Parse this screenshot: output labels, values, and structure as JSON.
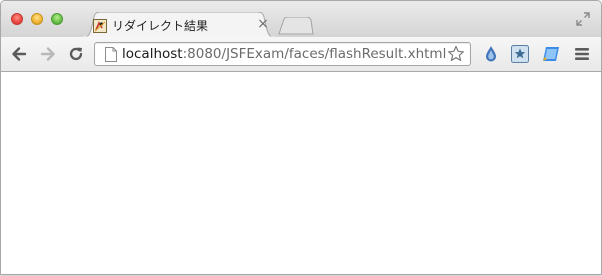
{
  "window": {
    "controls": [
      "close-icon",
      "minimize-icon",
      "zoom-icon"
    ]
  },
  "tabs": [
    {
      "title": "リダイレクト結果",
      "favicon": "java-duke-favicon-icon",
      "close_glyph": "×",
      "active": true
    }
  ],
  "new_tab": {
    "icon": "new-tab-icon"
  },
  "toolbar": {
    "back_icon": "back-arrow-icon",
    "forward_icon": "forward-arrow-icon",
    "reload_icon": "reload-icon",
    "menu_icon": "hamburger-menu-icon"
  },
  "address_bar": {
    "host": "localhost",
    "path": ":8080/JSFExam/faces/flashResult.xhtml",
    "page_icon": "page-icon",
    "bookmark_icon": "star-icon"
  },
  "extensions": [
    {
      "name": "drop-icon",
      "color": "#4a7fc1"
    },
    {
      "name": "bookmark-star-icon",
      "color": "#5a8fbf"
    },
    {
      "name": "edit-icon",
      "color": "#3d8de8"
    }
  ],
  "colors": {
    "titlebar": "#d9d9d9",
    "toolbar": "#eeeeee",
    "tab_active": "#f4f4f4",
    "content_bg": "#ffffff"
  }
}
